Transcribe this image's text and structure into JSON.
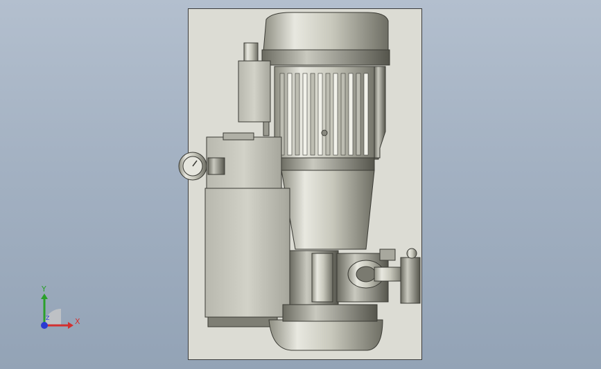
{
  "viewport": {
    "background_top": "#b3bfce",
    "background_bottom": "#93a3b6"
  },
  "model": {
    "description_icon": "pump-assembly-icon",
    "body_color": "#cfcfc4",
    "sheet_color": "#dcdcd4"
  },
  "triad": {
    "x_label": "X",
    "y_label": "Y",
    "z_label": "Z",
    "x_color": "#d23030",
    "y_color": "#2aa02a",
    "z_color": "#2a3ad2"
  }
}
